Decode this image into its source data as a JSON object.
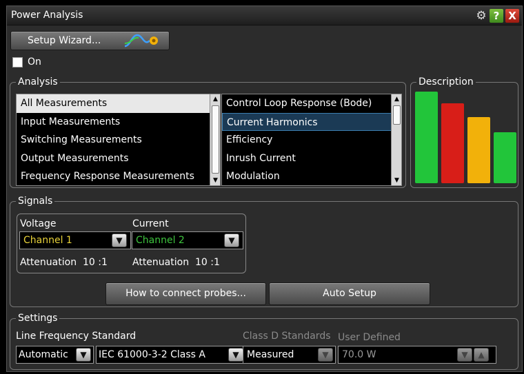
{
  "window": {
    "title": "Power Analysis",
    "help_label": "?",
    "close_label": "X"
  },
  "toolbar": {
    "setup_wizard_label": "Setup Wizard...",
    "on_label": "On",
    "on_checked": false
  },
  "analysis": {
    "group_label": "Analysis",
    "categories": [
      "All Measurements",
      "Input Measurements",
      "Switching Measurements",
      "Output Measurements",
      "Frequency Response Measurements"
    ],
    "selected_category": "All Measurements",
    "measurements": [
      "Control Loop Response (Bode)",
      "Current Harmonics",
      "Efficiency",
      "Inrush Current",
      "Modulation"
    ],
    "selected_measurement": "Current Harmonics"
  },
  "description": {
    "group_label": "Description",
    "bar_colors": [
      "#22c53a",
      "#d81e18",
      "#f2b10a",
      "#22c53a"
    ],
    "bar_levels": [
      1.0,
      0.87,
      0.72,
      0.56
    ]
  },
  "signals": {
    "group_label": "Signals",
    "voltage": {
      "header": "Voltage",
      "channel": "Channel 1",
      "channel_color": "#e8d23a",
      "attenuation": "Attenuation  10 :1"
    },
    "current": {
      "header": "Current",
      "channel": "Channel 2",
      "channel_color": "#3ec43e",
      "attenuation": "Attenuation  10 :1"
    },
    "probes_button": "How to connect probes...",
    "auto_setup_button": "Auto Setup"
  },
  "settings": {
    "group_label": "Settings",
    "line_freq_label": "Line Frequency Standard",
    "line_freq_value": "Automatic",
    "standard_value": "IEC 61000-3-2 Class A",
    "class_d_label": "Class D Standards",
    "class_d_value": "Measured",
    "user_defined_label": "User Defined",
    "user_defined_value": "70.0 W"
  }
}
